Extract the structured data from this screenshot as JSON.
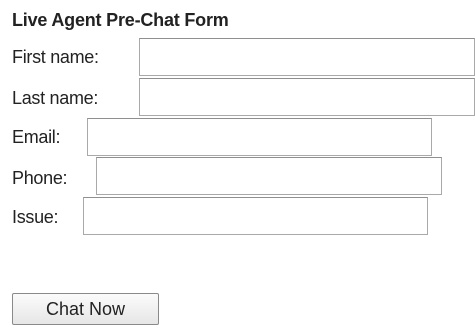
{
  "form": {
    "title": "Live Agent Pre-Chat Form",
    "fields": {
      "first_name": {
        "label": "First name:",
        "value": "",
        "placeholder": ""
      },
      "last_name": {
        "label": "Last name:",
        "value": "",
        "placeholder": ""
      },
      "email": {
        "label": "Email:",
        "value": "",
        "placeholder": ""
      },
      "phone": {
        "label": "Phone:",
        "value": "",
        "placeholder": ""
      },
      "issue": {
        "label": "Issue:",
        "value": "",
        "placeholder": ""
      }
    },
    "submit_label": "Chat Now"
  }
}
